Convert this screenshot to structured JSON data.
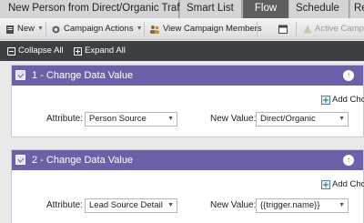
{
  "tabs": {
    "program_name": "New Person from Direct/Organic Traffic",
    "smart_list": "Smart List",
    "flow": "Flow",
    "schedule": "Schedule",
    "results_partial": "Re"
  },
  "toolbar": {
    "new_label": "New",
    "campaign_actions_label": "Campaign Actions",
    "view_members_label": "View Campaign Members",
    "active_campaign_label": "Active Campaig"
  },
  "toolbar2": {
    "collapse_all": "Collapse All",
    "expand_all": "Expand All"
  },
  "steps": [
    {
      "title": "1 - Change Data Value",
      "add_choice": "Add Choic",
      "attribute_label": "Attribute:",
      "attribute_value": "Person Source",
      "new_value_label": "New Value:",
      "new_value": "Direct/Organic"
    },
    {
      "title": "2 - Change Data Value",
      "add_choice": "Add Choic",
      "attribute_label": "Attribute:",
      "attribute_value": "Lead Source Detail",
      "new_value_label": "New Value:",
      "new_value": "{{trigger.name}}"
    }
  ],
  "colors": {
    "flow_tab": "#5e5e5e",
    "step_header": "#6b61a8",
    "toolbar2_bg": "#3c3f44"
  }
}
